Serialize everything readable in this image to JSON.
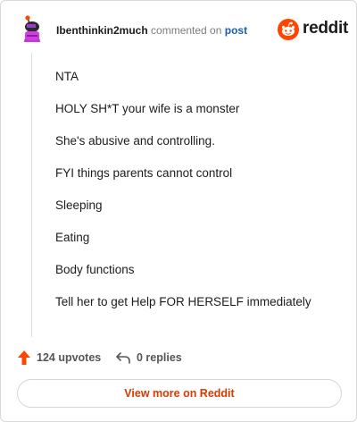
{
  "comment": {
    "username": "Ibenthinkin2much",
    "action_text": "commented on",
    "post_link_text": "post",
    "paragraphs": [
      "NTA",
      "HOLY SH*T your wife is a monster",
      "She's abusive and controlling.",
      "FYI things parents cannot control",
      "Sleeping",
      "Eating",
      "Body functions",
      "Tell her to get Help FOR HERSELF immediately"
    ]
  },
  "brand": {
    "wordmark": "reddit",
    "icon": "reddit-snoo-icon",
    "accent_color": "#ff4500"
  },
  "footer": {
    "upvotes_label": "124 upvotes",
    "replies_label": "0 replies"
  },
  "cta": {
    "label": "View more on Reddit",
    "color": "#d93a00"
  }
}
